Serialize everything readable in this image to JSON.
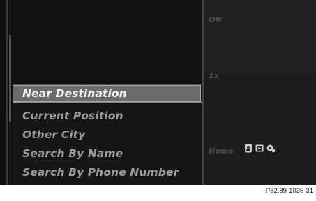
{
  "menu": {
    "items": [
      {
        "label": "Near Destination",
        "selected": true
      },
      {
        "label": "Current Position",
        "selected": false
      },
      {
        "label": "Other City",
        "selected": false
      },
      {
        "label": "Search By Name",
        "selected": false
      },
      {
        "label": "Search By Phone Number",
        "selected": false
      }
    ]
  },
  "right_panel": {
    "ghost_top": "Off",
    "ghost_mid": "1x",
    "ghost_bottom": "Home",
    "icons": [
      "contacts-icon",
      "media-icon",
      "settings-icon"
    ]
  },
  "footer": {
    "code": "P82.89-1035-31"
  }
}
